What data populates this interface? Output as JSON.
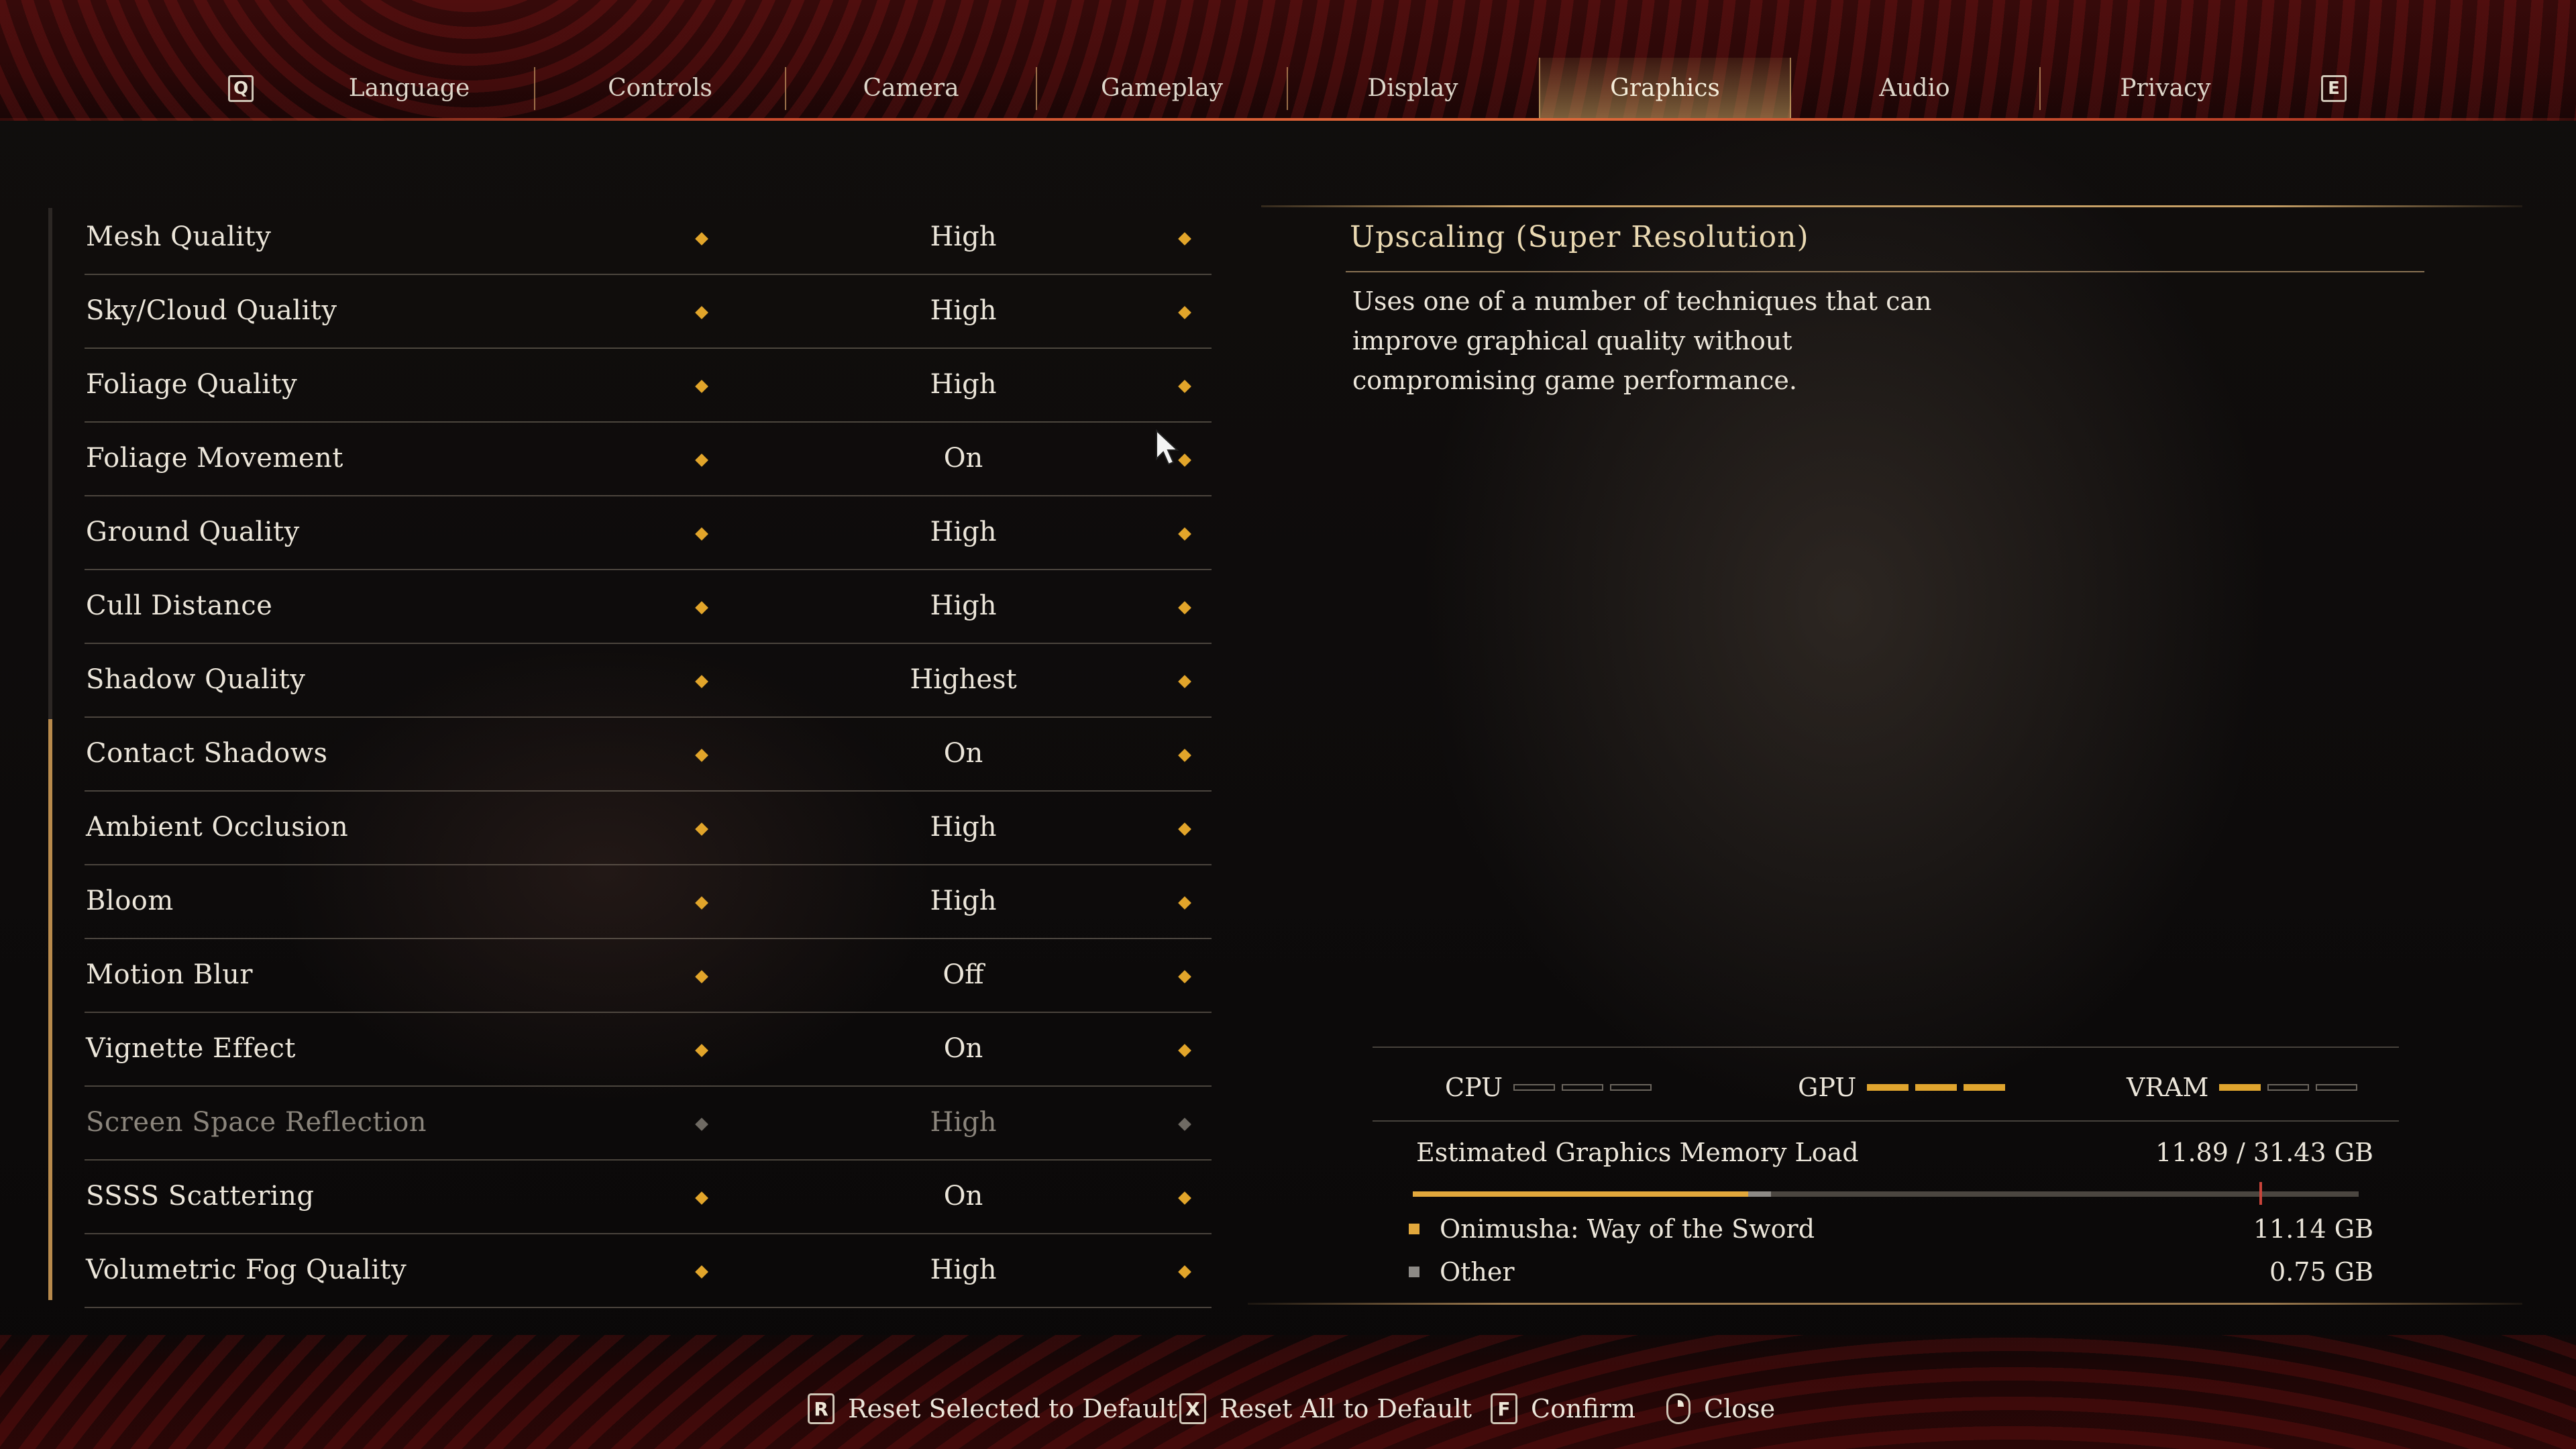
{
  "tabs": {
    "prev_key": "Q",
    "next_key": "E",
    "items": [
      {
        "label": "Language"
      },
      {
        "label": "Controls"
      },
      {
        "label": "Camera"
      },
      {
        "label": "Gameplay"
      },
      {
        "label": "Display"
      },
      {
        "label": "Graphics"
      },
      {
        "label": "Audio"
      },
      {
        "label": "Privacy"
      }
    ],
    "active": "Graphics"
  },
  "settings": [
    {
      "label": "Mesh Quality",
      "value": "High"
    },
    {
      "label": "Sky/Cloud Quality",
      "value": "High"
    },
    {
      "label": "Foliage Quality",
      "value": "High"
    },
    {
      "label": "Foliage Movement",
      "value": "On"
    },
    {
      "label": "Ground Quality",
      "value": "High"
    },
    {
      "label": "Cull Distance",
      "value": "High"
    },
    {
      "label": "Shadow Quality",
      "value": "Highest"
    },
    {
      "label": "Contact Shadows",
      "value": "On"
    },
    {
      "label": "Ambient Occlusion",
      "value": "High"
    },
    {
      "label": "Bloom",
      "value": "High"
    },
    {
      "label": "Motion Blur",
      "value": "Off"
    },
    {
      "label": "Vignette Effect",
      "value": "On"
    },
    {
      "label": "Screen Space Reflection",
      "value": "High",
      "disabled": true
    },
    {
      "label": "SSSS Scattering",
      "value": "On"
    },
    {
      "label": "Volumetric Fog Quality",
      "value": "High"
    }
  ],
  "detail": {
    "title": "Upscaling (Super Resolution)",
    "description": "Uses one of a number of techniques that can improve graphical quality without compromising game performance."
  },
  "performance": {
    "cpu_label": "CPU",
    "cpu_level": 0,
    "gpu_label": "GPU",
    "gpu_level": 3,
    "vram_label": "VRAM",
    "vram_level": 1,
    "max_level": 3
  },
  "memory": {
    "title": "Estimated Graphics Memory Load",
    "total": "11.89 / 31.43 GB",
    "used_gb": 11.89,
    "capacity_gb": 31.43,
    "items": [
      {
        "name": "Onimusha: Way of the Sword",
        "value": "11.14 GB",
        "gb": 11.14,
        "color": "#e2a83c"
      },
      {
        "name": "Other",
        "value": "0.75 GB",
        "gb": 0.75,
        "color": "#8d8a86"
      }
    ]
  },
  "footer": [
    {
      "key": "R",
      "label": "Reset Selected to Default"
    },
    {
      "key": "X",
      "label": "Reset All to Default"
    },
    {
      "key": "F",
      "label": "Confirm"
    },
    {
      "key": "",
      "label": "Close",
      "mouse": true
    }
  ],
  "colors": {
    "accent": "#e2a52a",
    "active_tab": "#c8a064",
    "memory_limit": "#c9443a"
  }
}
